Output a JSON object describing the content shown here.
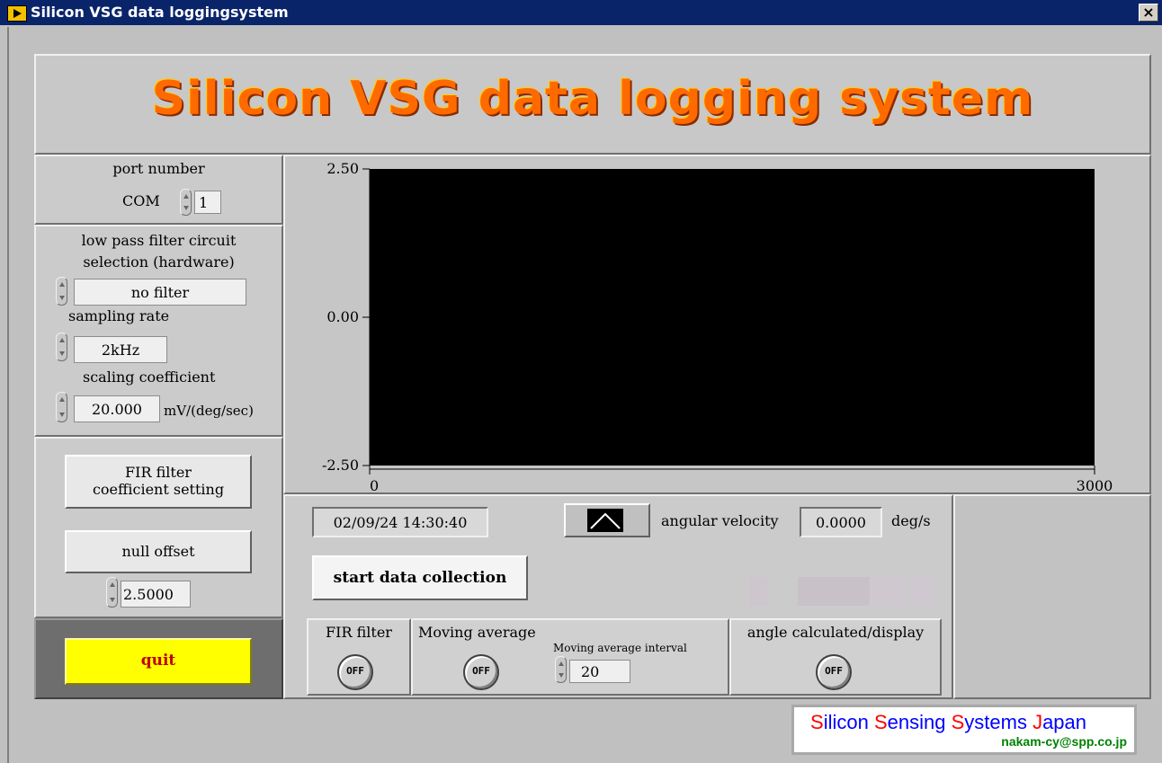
{
  "window": {
    "title": "Silicon VSG data loggingsystem",
    "close_glyph": "×"
  },
  "banner": {
    "title": "Silicon VSG data logging system"
  },
  "port": {
    "label": "port number",
    "prefix": "COM",
    "value": "1"
  },
  "filter": {
    "label_line1": "low pass filter circuit",
    "label_line2": "selection (hardware)",
    "value": "no filter"
  },
  "sampling": {
    "label": "sampling rate",
    "value": "2kHz"
  },
  "scaling": {
    "label": "scaling coefficient",
    "value": "20.000",
    "unit": "mV/(deg/sec)"
  },
  "fir_button": {
    "line1": "FIR filter",
    "line2": "coefficient setting"
  },
  "null_offset": {
    "label": "null offset",
    "value": "2.5000"
  },
  "quit": {
    "label": "quit"
  },
  "chart_data": {
    "type": "line",
    "ylim": [
      -2.5,
      2.5
    ],
    "xlim": [
      0,
      3000
    ],
    "y_ticks": [
      "2.50",
      "0.00",
      "-2.50"
    ],
    "x_ticks": [
      "0",
      "3000"
    ],
    "series": [],
    "background": "#000000"
  },
  "status": {
    "datetime": "02/09/24 14:30:40",
    "angular_label": "angular velocity",
    "angular_value": "0.0000",
    "angular_unit": "deg/s",
    "start_label": "start data collection"
  },
  "options": {
    "fir_label": "FIR filter",
    "fir_state": "OFF",
    "ma_label": "Moving average",
    "ma_state": "OFF",
    "ma_interval_label": "Moving average interval",
    "ma_interval_value": "20",
    "angle_label": "angle calculated/display",
    "angle_state": "OFF"
  },
  "logo": {
    "word1": "Silicon",
    "word2": "Sensing",
    "word3": "Systems",
    "word4": "Japan",
    "email": "nakam-cy@spp.co.jp"
  },
  "colors": {
    "accent_orange": "#ff6a00",
    "quit_yellow": "#ffff00",
    "logo_blue": "#0000ff",
    "logo_red": "#ff0000",
    "logo_green": "#008000"
  }
}
